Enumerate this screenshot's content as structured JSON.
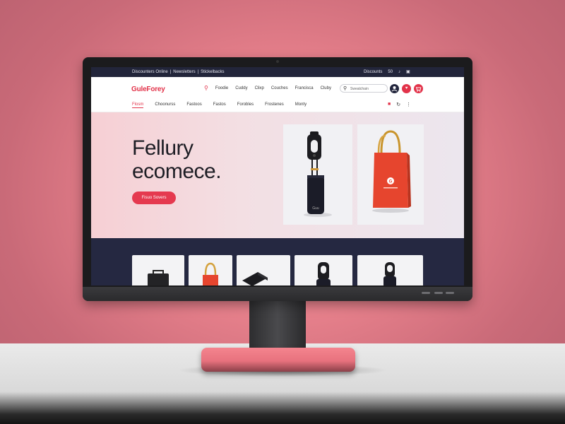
{
  "util_bar": {
    "left_links": [
      "Discounters Online",
      "Newsletters",
      "Stickelbacks"
    ],
    "right_label": "Discounts",
    "right_count": "50"
  },
  "header": {
    "logo": "GuleForey",
    "nav": [
      "Foodie",
      "Cuddy",
      "Clixp",
      "Couches",
      "Francisca",
      "Cluby"
    ],
    "search_placeholder": "Sweatchain",
    "circles": [
      {
        "icon": "user-icon",
        "color": "#23263d"
      },
      {
        "icon": "heart-icon",
        "color": "#e2334a"
      },
      {
        "icon": "cart-icon",
        "color": "#e2334a"
      }
    ]
  },
  "subnav": {
    "categories": [
      "Flosm",
      "Choonurss",
      "Fastoos",
      "Fastos",
      "Forobles",
      "Frostenes",
      "Monty"
    ],
    "active_index": 0
  },
  "hero": {
    "title_line1": "Fellury",
    "title_line2": "ecomece.",
    "cta_label": "Fisuo Sovers",
    "bag_logo": "G",
    "bottle_label": "Guu"
  },
  "colors": {
    "accent": "#e2334a",
    "navy": "#23263d"
  }
}
